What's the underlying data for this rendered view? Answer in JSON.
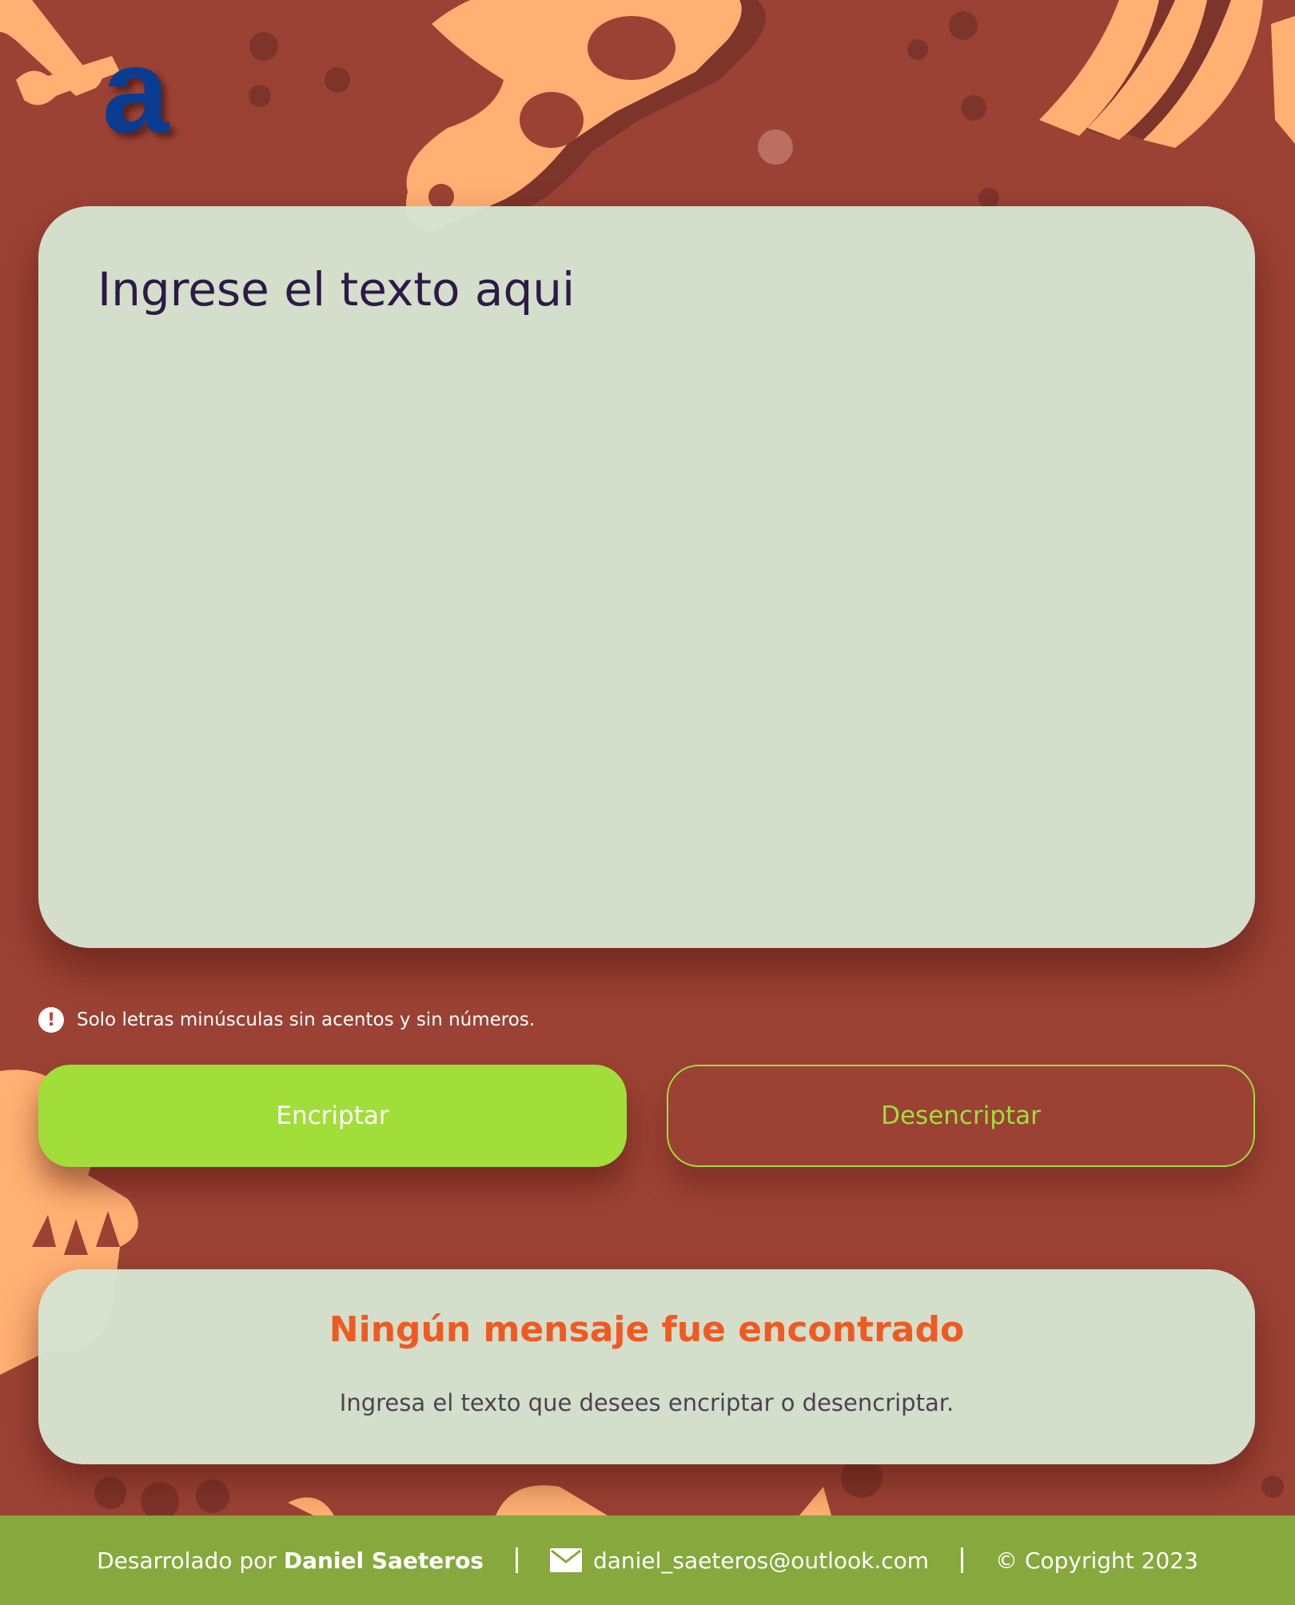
{
  "brand": {
    "logo_letter": "a"
  },
  "input": {
    "placeholder": "Ingrese el texto aqui"
  },
  "notice": {
    "icon": "exclamation-icon",
    "text": "Solo letras minúsculas sin acentos y sin números."
  },
  "buttons": {
    "encrypt": "Encriptar",
    "decrypt": "Desencriptar"
  },
  "output": {
    "title": "Ningún mensaje fue encontrado",
    "subtitle": "Ingresa el texto que desees encriptar o desencriptar."
  },
  "footer": {
    "credit_prefix": "Desarrolado por",
    "author": "Daniel Saeteros",
    "email_icon": "mail-icon",
    "email": "daniel_saeteros@outlook.com",
    "copyright": "© Copyright 2023"
  },
  "colors": {
    "background": "#9b4234",
    "card": "#d5e3d1",
    "primary_button": "#a1de3a",
    "title_accent": "#f05a22",
    "footer": "#86a83d",
    "logo": "#0a3d91"
  }
}
